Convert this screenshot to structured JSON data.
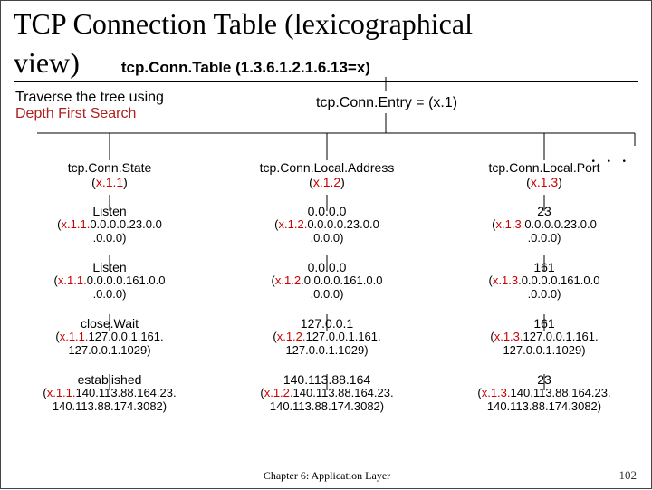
{
  "title_line1": "TCP Connection Table (lexicographical",
  "title_line2_prefix": "view)",
  "title_sub": "tcp.Conn.Table (1.3.6.1.2.1.6.13=x)",
  "traverse_line1": "Traverse the tree using",
  "traverse_line2": "Depth First Search",
  "entry_label": "tcp.Conn.Entry = (x.1)",
  "dots": ". . .",
  "columns": [
    {
      "head_name": "tcp.Conn.State",
      "head_oid_prefix": "(",
      "head_oid_red": "x.1.1",
      "head_oid_suffix": ")",
      "rows": [
        {
          "val": "Listen",
          "oid_prefix": "(",
          "oid_red": "x.1.1.",
          "oid_mid": "0.0.0.0.23.0.0\n.0.0.0)"
        },
        {
          "val": "Listen",
          "oid_prefix": "(",
          "oid_red": "x.1.1.",
          "oid_mid": "0.0.0.0.161.0.0\n.0.0.0)"
        },
        {
          "val": "close.Wait",
          "oid_prefix": "(",
          "oid_red": "x.1.1.",
          "oid_mid": "127.0.0.1.161.\n127.0.0.1.1029)"
        },
        {
          "val": "established",
          "oid_prefix": "(",
          "oid_red": "x.1.1.",
          "oid_mid": "140.113.88.164.23.\n140.113.88.174.3082)"
        }
      ]
    },
    {
      "head_name": "tcp.Conn.Local.Address",
      "head_oid_prefix": "(",
      "head_oid_red": "x.1.2",
      "head_oid_suffix": ")",
      "rows": [
        {
          "val": "0.0.0.0",
          "oid_prefix": "(",
          "oid_red": "x.1.2.",
          "oid_mid": "0.0.0.0.23.0.0\n.0.0.0)"
        },
        {
          "val": "0.0.0.0",
          "oid_prefix": "(",
          "oid_red": "x.1.2.",
          "oid_mid": "0.0.0.0.161.0.0\n.0.0.0)"
        },
        {
          "val": "127.0.0.1",
          "oid_prefix": "(",
          "oid_red": "x.1.2.",
          "oid_mid": "127.0.0.1.161.\n127.0.0.1.1029)"
        },
        {
          "val": "140.113.88.164",
          "oid_prefix": "(",
          "oid_red": "x.1.2.",
          "oid_mid": "140.113.88.164.23.\n140.113.88.174.3082)"
        }
      ]
    },
    {
      "head_name": "tcp.Conn.Local.Port",
      "head_oid_prefix": "(",
      "head_oid_red": "x.1.3",
      "head_oid_suffix": ")",
      "rows": [
        {
          "val": "23",
          "oid_prefix": "(",
          "oid_red": "x.1.3.",
          "oid_mid": "0.0.0.0.23.0.0\n.0.0.0)"
        },
        {
          "val": "161",
          "oid_prefix": "(",
          "oid_red": "x.1.3.",
          "oid_mid": "0.0.0.0.161.0.0\n.0.0.0)"
        },
        {
          "val": "161",
          "oid_prefix": "(",
          "oid_red": "x.1.3.",
          "oid_mid": "127.0.0.1.161.\n127.0.0.1.1029)"
        },
        {
          "val": "23",
          "oid_prefix": "(",
          "oid_red": "x.1.3.",
          "oid_mid": "140.113.88.164.23.\n140.113.88.174.3082)"
        }
      ]
    }
  ],
  "footer": "Chapter 6: Application Layer",
  "pagenum": "102"
}
